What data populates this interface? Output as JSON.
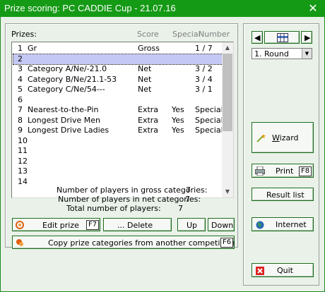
{
  "window": {
    "title": "Prize scoring: PC CADDIE Cup - 21.07.16",
    "close_glyph": "✕"
  },
  "list": {
    "header_prizes": "Prizes:",
    "header_score": "Score",
    "header_special": "Special",
    "header_number": "Number",
    "rows": [
      {
        "num": "1",
        "name": "Gr",
        "score": "Gross",
        "special": "",
        "number": "1 / 7"
      },
      {
        "num": "2",
        "name": "",
        "score": "",
        "special": "",
        "number": ""
      },
      {
        "num": "3",
        "name": "Category A/Ne/-21.0",
        "score": "Net",
        "special": "",
        "number": "3 / 2"
      },
      {
        "num": "4",
        "name": "Category B/Ne/21.1-53",
        "score": "Net",
        "special": "",
        "number": "3 / 4"
      },
      {
        "num": "5",
        "name": "Category C/Ne/54---",
        "score": "Net",
        "special": "",
        "number": "3 / 1"
      },
      {
        "num": "6",
        "name": "",
        "score": "",
        "special": "",
        "number": ""
      },
      {
        "num": "7",
        "name": "Nearest-to-the-Pin",
        "score": "Extra",
        "special": "Yes",
        "number": "Special"
      },
      {
        "num": "8",
        "name": "Longest Drive Men",
        "score": "Extra",
        "special": "Yes",
        "number": "Special"
      },
      {
        "num": "9",
        "name": "Longest Drive Ladies",
        "score": "Extra",
        "special": "Yes",
        "number": "Special"
      },
      {
        "num": "10",
        "name": "",
        "score": "",
        "special": "",
        "number": ""
      },
      {
        "num": "11",
        "name": "",
        "score": "",
        "special": "",
        "number": ""
      },
      {
        "num": "12",
        "name": "",
        "score": "",
        "special": "",
        "number": ""
      },
      {
        "num": "13",
        "name": "",
        "score": "",
        "special": "",
        "number": ""
      },
      {
        "num": "14",
        "name": "",
        "score": "",
        "special": "",
        "number": ""
      }
    ]
  },
  "stats": {
    "gross_label": "Number of players in gross categories:",
    "gross_value": "7",
    "net_label": "Number of players in net categories:",
    "net_value": "7",
    "total_label": "Total number of players:",
    "total_value": "7"
  },
  "buttons": {
    "edit_prize": "Edit prize",
    "edit_key": "F7",
    "delete": "... Delete",
    "up": "Up",
    "down": "Down",
    "copy": "Copy prize categories from another competition",
    "copy_key": "F6",
    "wizard": "Wizard",
    "print": "Print",
    "print_key": "F8",
    "result_list": "Result list",
    "internet": "Internet",
    "quit": "Quit"
  },
  "round_select": {
    "value": "1. Round"
  },
  "colors": {
    "accent": "#159a16",
    "selection": "#c4c8f4"
  }
}
